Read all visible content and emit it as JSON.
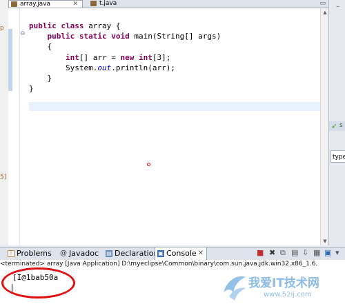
{
  "editor_tabs": [
    {
      "label": "array.java",
      "close": "✕"
    },
    {
      "label": "t.java"
    }
  ],
  "editor_controls": "▭",
  "left_markers": [
    "p",
    "5]"
  ],
  "code_lines": [
    "public class array {",
    "    public static void main(String[] args)",
    "    {",
    "        int[] arr = new int[3];",
    "        System.out.println(arr);",
    "    }",
    "}"
  ],
  "fold_icon": "⊖",
  "right_panel": {
    "header_label": "s",
    "type_field": "type"
  },
  "console_tabs": [
    {
      "label": "Problems",
      "icon": "!"
    },
    {
      "label": "Javadoc",
      "icon": "@"
    },
    {
      "label": "Declaration",
      "icon": "▤"
    },
    {
      "label": "Console",
      "icon": "▣",
      "close": "✕"
    }
  ],
  "console_status": "<terminated> array [Java Application] D:\\myeclipse\\Common\\binary\\com.sun.java.jdk.win32.x86_1.6.",
  "console_output": "[I@1bab50a",
  "watermark": {
    "text": "我爱IT技术网",
    "url": "www.52ij.com"
  },
  "colors": {
    "keyword": "#7f0055",
    "field": "#0000c0",
    "annotation": "#e01010"
  }
}
